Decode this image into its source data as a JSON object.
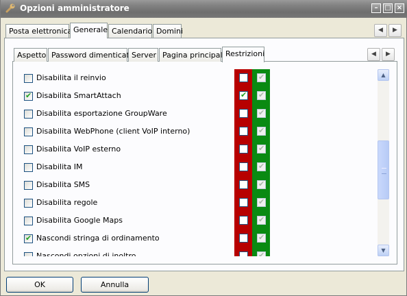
{
  "window": {
    "title": "Opzioni amministratore",
    "icon": "wrench-icon"
  },
  "outer_tabs": [
    {
      "label": "Posta elettronica"
    },
    {
      "label": "Generale",
      "active": true
    },
    {
      "label": "Calendario"
    },
    {
      "label": "Domini"
    }
  ],
  "inner_tabs": [
    {
      "label": "Aspetto"
    },
    {
      "label": "Password dimenticata"
    },
    {
      "label": "Server"
    },
    {
      "label": "Pagina principale"
    },
    {
      "label": "Restrizioni",
      "active": true
    }
  ],
  "restrictions": [
    {
      "label": "Disabilita il reinvio",
      "checked": false,
      "red_checked": false,
      "green_checked": true
    },
    {
      "label": "Disabilita SmartAttach",
      "checked": true,
      "red_checked": true,
      "green_checked": true
    },
    {
      "label": "Disabilita esportazione GroupWare",
      "checked": false,
      "red_checked": false,
      "green_checked": true
    },
    {
      "label": "Disabilita WebPhone (client VoIP interno)",
      "checked": false,
      "red_checked": false,
      "green_checked": true
    },
    {
      "label": "Disabilita VoIP esterno",
      "checked": false,
      "red_checked": false,
      "green_checked": true
    },
    {
      "label": "Disabilita IM",
      "checked": false,
      "red_checked": false,
      "green_checked": true
    },
    {
      "label": "Disabilita SMS",
      "checked": false,
      "red_checked": false,
      "green_checked": true
    },
    {
      "label": "Disabilita regole",
      "checked": false,
      "red_checked": false,
      "green_checked": true
    },
    {
      "label": "Disabilita Google Maps",
      "checked": false,
      "red_checked": false,
      "green_checked": true
    },
    {
      "label": "Nascondi stringa di ordinamento",
      "checked": true,
      "red_checked": false,
      "green_checked": true
    },
    {
      "label": "Nascondi opzioni di inoltro",
      "checked": false,
      "red_checked": false,
      "green_checked": true
    }
  ],
  "buttons": {
    "ok": "OK",
    "cancel": "Annulla"
  },
  "colors": {
    "red_column": "#b70000",
    "green_column": "#0a8a12",
    "title_bar": "#7e7e7e"
  }
}
